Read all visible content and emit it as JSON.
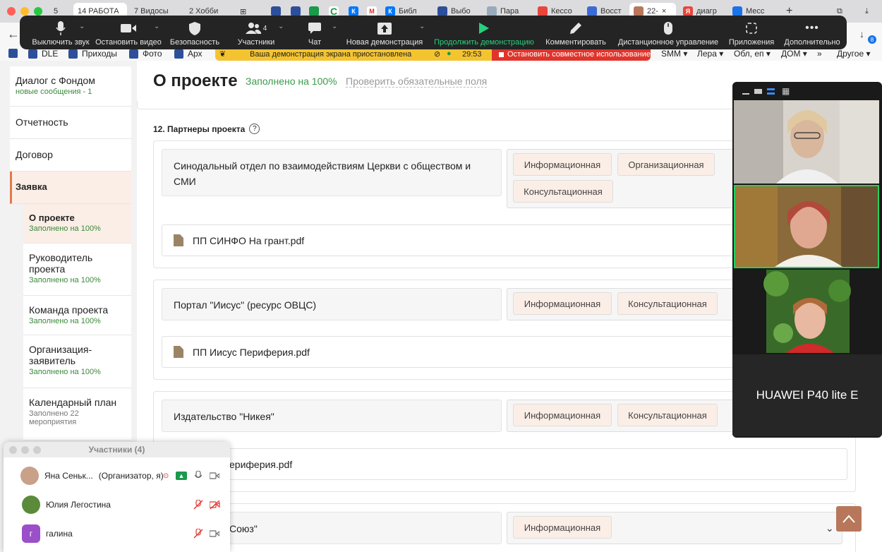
{
  "browser": {
    "tabs": [
      {
        "label": "5"
      },
      {
        "label": "14 РАБОТА"
      },
      {
        "label": "7 Видосы"
      },
      {
        "label": "2 Хобби"
      },
      {
        "label": "Библ"
      },
      {
        "label": "Выбо"
      },
      {
        "label": "Пара"
      },
      {
        "label": "Кессо"
      },
      {
        "label": "Восст"
      },
      {
        "label": "22-"
      },
      {
        "label": "диагр"
      },
      {
        "label": "Месс"
      }
    ],
    "bookmarks": {
      "left": [
        "DLE",
        "Приходы",
        "Фото",
        "Арх"
      ],
      "right": [
        "SMM ▾",
        "Лера ▾",
        "Обл, еп ▾",
        "ДОМ ▾",
        "»",
        "Другое ▾"
      ]
    },
    "downloads_badge": "8"
  },
  "zoom_toolbar": {
    "participants_count": "4",
    "items": [
      "Выключить звук",
      "Остановить видео",
      "Безопасность",
      "Участники",
      "Чат",
      "Новая демонстрация",
      "Продолжить демонстрацию",
      "Комментировать",
      "Дистанционное управление",
      "Приложения",
      "Дополнительно"
    ]
  },
  "share_banner": {
    "message": "Ваша демонстрация экрана приостановлена",
    "timer": "29:53",
    "stop_label": "Остановить совместное использование"
  },
  "sidebar": {
    "items": [
      {
        "title": "Диалог с Фондом",
        "subtitle": "новые сообщения - 1"
      },
      {
        "title": "Отчетность",
        "subtitle": ""
      },
      {
        "title": "Договор",
        "subtitle": ""
      },
      {
        "title": "Заявка",
        "subtitle": ""
      },
      {
        "title": "О проекте",
        "subtitle": "Заполнено на 100%"
      },
      {
        "title": "Руководитель проекта",
        "subtitle": "Заполнено на 100%"
      },
      {
        "title": "Команда проекта",
        "subtitle": "Заполнено на 100%"
      },
      {
        "title": "Организация-заявитель",
        "subtitle": "Заполнено на 100%"
      },
      {
        "title": "Календарный план",
        "subtitle": "Заполнено 22 мероприятия"
      }
    ]
  },
  "header": {
    "title": "О проекте",
    "filled": "Заполнено на 100%",
    "check_link": "Проверить обязательные поля"
  },
  "section": {
    "title": "12. Партнеры проекта",
    "help": "?"
  },
  "partners": [
    {
      "name": "Синодальный отдел по взаимодействиям Церкви с обществом и СМИ",
      "tags": [
        "Информационная",
        "Организационная",
        "Консультационная"
      ],
      "file": "ПП СИНФО На грант.pdf"
    },
    {
      "name": "Портал \"Иисус\" (ресурс ОВЦС)",
      "tags": [
        "Информационная",
        "Консультационная"
      ],
      "file": "ПП Иисус Периферия.pdf"
    },
    {
      "name": "Издательство \"Никея\"",
      "tags": [
        "Информационная",
        "Консультационная"
      ],
      "file": "ериферия.pdf"
    },
    {
      "name": "Союз\"",
      "tags": [
        "Информационная"
      ],
      "file": ""
    }
  ],
  "gallery": {
    "device_name": "HUAWEI P40 lite E"
  },
  "participants_panel": {
    "title": "Участники (4)",
    "people": [
      {
        "name": "Яна Сеньк...",
        "role": "(Организатор, я)",
        "initial": ""
      },
      {
        "name": "Юлия Легостина",
        "role": "",
        "initial": ""
      },
      {
        "name": "галина",
        "role": "",
        "initial": "г"
      }
    ]
  },
  "colors": {
    "accent": "#e07a4a",
    "success": "#3a9a4a",
    "zoom_green": "#26d07c",
    "stop_red": "#e0342b",
    "banner_yellow": "#f4c430"
  }
}
